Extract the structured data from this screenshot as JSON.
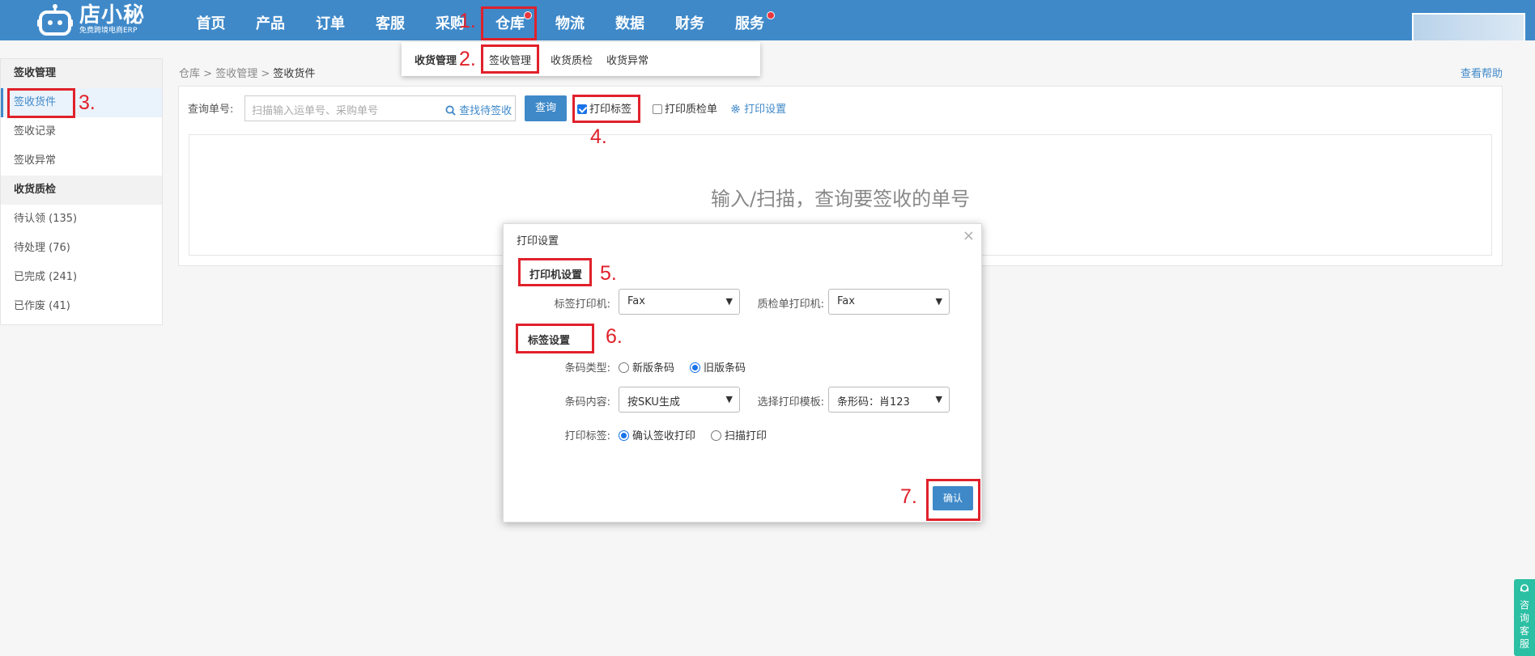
{
  "logo": {
    "title": "店小秘",
    "subtitle": "免费跨境电商ERP"
  },
  "nav": {
    "items": [
      "首页",
      "产品",
      "订单",
      "客服",
      "采购",
      "仓库",
      "物流",
      "数据",
      "财务",
      "服务"
    ]
  },
  "subnav": {
    "group": "收货管理",
    "items": [
      "签收管理",
      "收货质检",
      "收货异常"
    ]
  },
  "sidebar": {
    "group1": "签收管理",
    "items1": [
      "签收货件",
      "签收记录",
      "签收异常"
    ],
    "group2": "收货质检",
    "items2": [
      "待认领 (135)",
      "待处理 (76)",
      "已完成 (241)",
      "已作废 (41)"
    ]
  },
  "breadcrumb": {
    "a": "仓库",
    "b": "签收管理",
    "c": "签收货件",
    "sep": ">"
  },
  "help_link": "查看帮助",
  "query": {
    "label": "查询单号:",
    "placeholder": "扫描输入运单号、采购单号",
    "find_link": "查找待签收",
    "button": "查询",
    "print_label": "打印标签",
    "print_qc": "打印质检单",
    "print_settings": "打印设置"
  },
  "empty_text": "输入/扫描，查询要签收的单号",
  "modal": {
    "title": "打印设置",
    "close": "×",
    "printer_section": "打印机设置",
    "label_printer_label": "标签打印机:",
    "label_printer_value": "Fax",
    "qc_printer_label": "质检单打印机:",
    "qc_printer_value": "Fax",
    "label_section": "标签设置",
    "barcode_type_label": "条码类型:",
    "barcode_new": "新版条码",
    "barcode_old": "旧版条码",
    "barcode_content_label": "条码内容:",
    "barcode_content_value": "按SKU生成",
    "template_label": "选择打印模板:",
    "template_value": "条形码：肖123",
    "print_label_label": "打印标签:",
    "print_on_confirm": "确认签收打印",
    "print_on_scan": "扫描打印",
    "confirm": "确认"
  },
  "annotations": [
    "1.",
    "2.",
    "3.",
    "4.",
    "5.",
    "6.",
    "7."
  ],
  "float_help": "咨询客服",
  "colors": {
    "primary": "#3f89c9",
    "annotation": "#e0212b",
    "float": "#2bbfa3"
  }
}
